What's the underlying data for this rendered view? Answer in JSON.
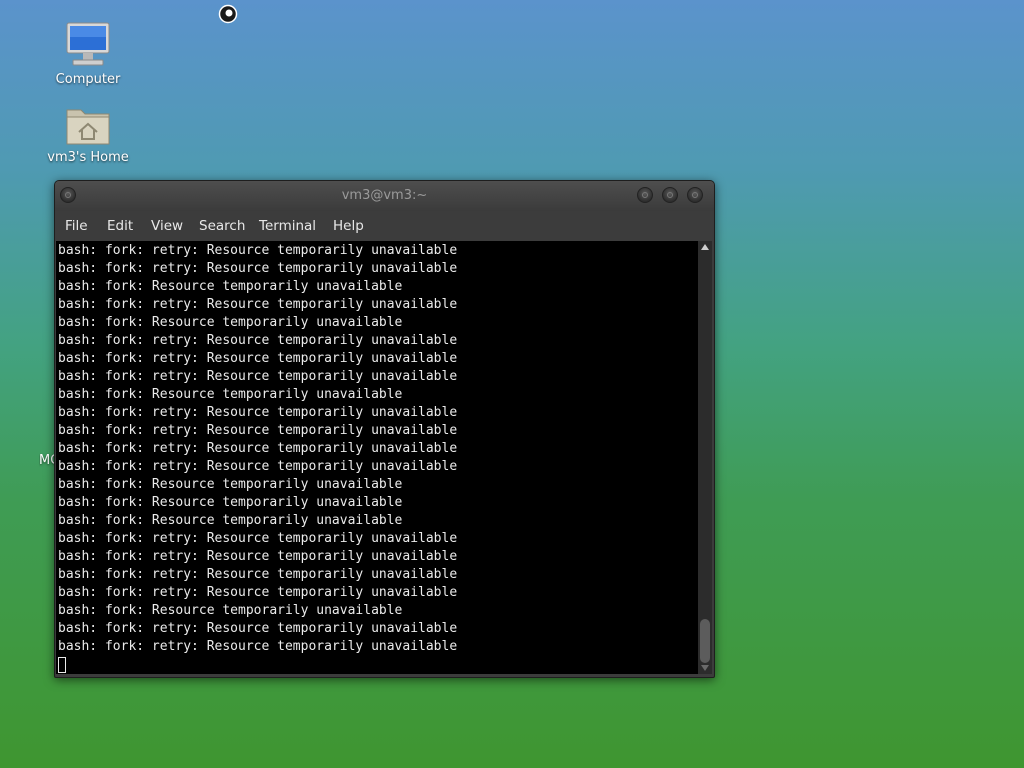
{
  "desktop": {
    "icons": [
      {
        "label": "Computer",
        "icon": "computer-icon"
      },
      {
        "label": "vm3's Home",
        "icon": "home-folder-icon"
      }
    ],
    "stray_text": "MC"
  },
  "terminal": {
    "title": "vm3@vm3:~",
    "menu": [
      "File",
      "Edit",
      "View",
      "Search",
      "Terminal",
      "Help"
    ],
    "lines": [
      "bash: fork: retry: Resource temporarily unavailable",
      "bash: fork: retry: Resource temporarily unavailable",
      "bash: fork: Resource temporarily unavailable",
      "bash: fork: retry: Resource temporarily unavailable",
      "bash: fork: Resource temporarily unavailable",
      "bash: fork: retry: Resource temporarily unavailable",
      "bash: fork: retry: Resource temporarily unavailable",
      "bash: fork: retry: Resource temporarily unavailable",
      "bash: fork: Resource temporarily unavailable",
      "bash: fork: retry: Resource temporarily unavailable",
      "bash: fork: retry: Resource temporarily unavailable",
      "bash: fork: retry: Resource temporarily unavailable",
      "bash: fork: retry: Resource temporarily unavailable",
      "bash: fork: Resource temporarily unavailable",
      "bash: fork: Resource temporarily unavailable",
      "bash: fork: Resource temporarily unavailable",
      "bash: fork: retry: Resource temporarily unavailable",
      "bash: fork: retry: Resource temporarily unavailable",
      "bash: fork: retry: Resource temporarily unavailable",
      "bash: fork: retry: Resource temporarily unavailable",
      "bash: fork: Resource temporarily unavailable",
      "bash: fork: retry: Resource temporarily unavailable",
      "bash: fork: retry: Resource temporarily unavailable"
    ]
  },
  "colors": {
    "terminal_bg": "#000000",
    "terminal_fg": "#ebebeb",
    "window_chrome": "#3c3c3c"
  }
}
